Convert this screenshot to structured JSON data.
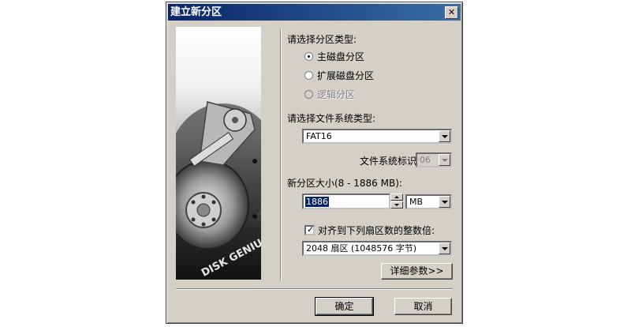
{
  "window": {
    "title": "建立新分区"
  },
  "partition_type": {
    "label": "请选择分区类型:",
    "options": [
      {
        "label": "主磁盘分区",
        "checked": true,
        "enabled": true
      },
      {
        "label": "扩展磁盘分区",
        "checked": false,
        "enabled": true
      },
      {
        "label": "逻辑分区",
        "checked": false,
        "enabled": false
      }
    ]
  },
  "filesystem": {
    "label": "请选择文件系统类型:",
    "value": "FAT16",
    "id_label": "文件系统标识:",
    "id_value": "06"
  },
  "size": {
    "label": "新分区大小(8 - 1886 MB):",
    "value": "1886",
    "unit": "MB"
  },
  "align": {
    "label": "对齐到下列扇区数的整数倍:",
    "checked": true,
    "value": "2048 扇区 (1048576 字节)"
  },
  "buttons": {
    "details": "详细参数>>",
    "ok": "确定",
    "cancel": "取消"
  },
  "art": {
    "logo_text": "DISK GENIUS"
  }
}
